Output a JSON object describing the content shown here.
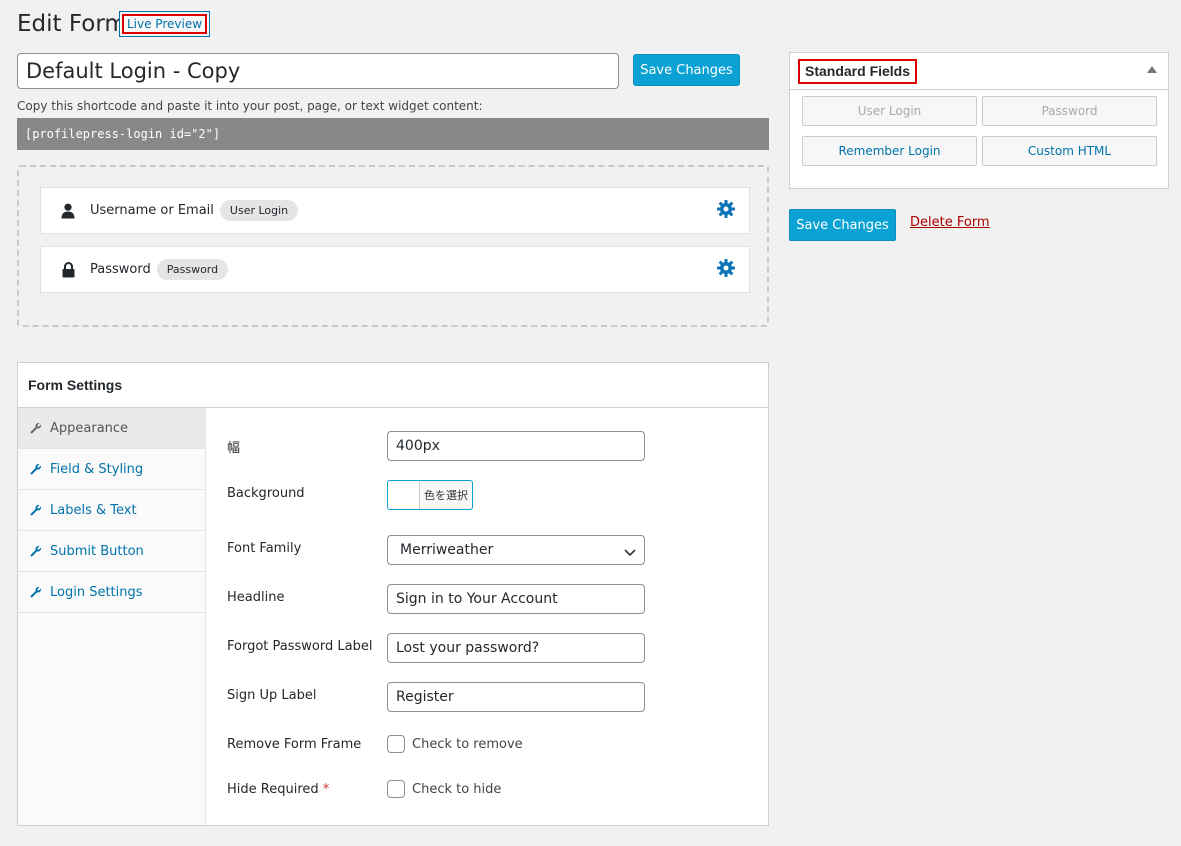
{
  "header": {
    "title": "Edit Form",
    "live_preview": "Live Preview"
  },
  "form_title": "Default Login - Copy",
  "save_label": "Save Changes",
  "shortcode_hint": "Copy this shortcode and paste it into your post, page, or text widget content:",
  "shortcode": "[profilepress-login id=\"2\"]",
  "builder": {
    "fields": [
      {
        "label": "Username or Email",
        "tag": "User Login",
        "icon": "user-icon"
      },
      {
        "label": "Password",
        "tag": "Password",
        "icon": "lock-icon"
      }
    ]
  },
  "settings": {
    "title": "Form Settings",
    "tabs": [
      {
        "label": "Appearance",
        "active": true
      },
      {
        "label": "Field & Styling"
      },
      {
        "label": "Labels & Text"
      },
      {
        "label": "Submit Button"
      },
      {
        "label": "Login Settings"
      }
    ],
    "width_label": "幅",
    "width_value": "400px",
    "background_label": "Background",
    "color_button": "色を選択",
    "font_family_label": "Font Family",
    "font_family_value": "Merriweather",
    "headline_label": "Headline",
    "headline_value": "Sign in to Your Account",
    "forgot_label": "Forgot Password Label",
    "forgot_value": "Lost your password?",
    "signup_label": "Sign Up Label",
    "signup_value": "Register",
    "remove_frame_label": "Remove Form Frame",
    "remove_frame_check": "Check to remove",
    "hide_required_label": "Hide Required",
    "hide_required_star": "*",
    "hide_required_check": "Check to hide"
  },
  "standard_fields": {
    "title": "Standard Fields",
    "buttons": [
      {
        "label": "User Login",
        "enabled": false
      },
      {
        "label": "Password",
        "enabled": false
      },
      {
        "label": "Remember Login",
        "enabled": true
      },
      {
        "label": "Custom HTML",
        "enabled": true
      }
    ]
  },
  "delete_label": "Delete Form",
  "colors": {
    "primary": "#0aa1d4",
    "link": "#0073aa",
    "delete": "#aa0000",
    "highlight_border": "#dd0000"
  }
}
